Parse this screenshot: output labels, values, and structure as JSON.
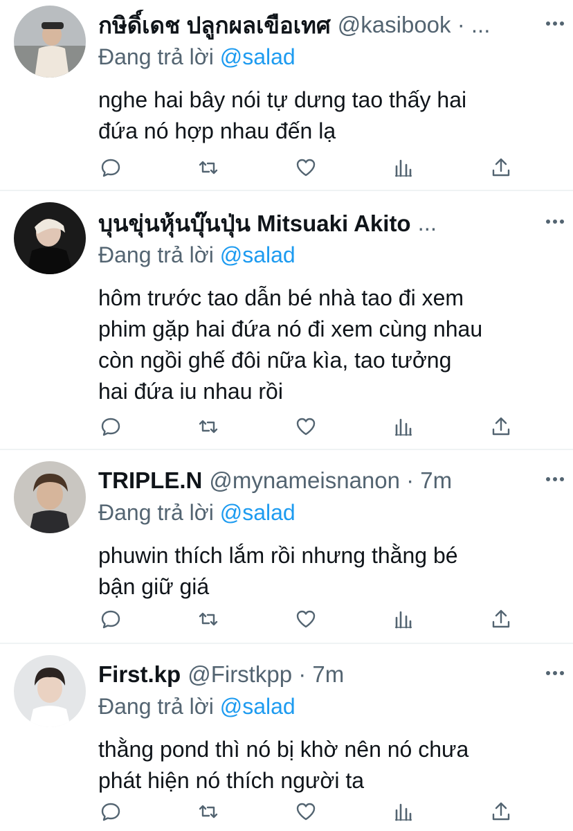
{
  "ui": {
    "accent": "#1d9bf0",
    "muted": "#536471",
    "text": "#0f1419"
  },
  "replies": [
    {
      "display_name": "กษิดิ์เดช ปลูกผลเขือเทศ",
      "handle": "@kasibook · ...",
      "replying_prefix": "Đang trả lời",
      "replying_to": "@salad",
      "text_lines": [
        "nghe hai bây nói tự dưng tao thấy hai",
        "đứa nó hợp nhau đến lạ"
      ]
    },
    {
      "display_name": "บุนขุ่นหุ้นบุ๊นปุ่น Mitsuaki Akito",
      "handle": "...",
      "replying_prefix": "Đang trả lời",
      "replying_to": "@salad",
      "text_lines": [
        "hôm trước tao dẫn bé nhà tao đi xem",
        "phim gặp hai đứa nó đi xem cùng nhau",
        "còn ngồi ghế đôi nữa kìa, tao tưởng",
        "hai đứa iu nhau rồi"
      ]
    },
    {
      "display_name": "TRIPLE.N",
      "handle": "@mynameisnanon · 7m",
      "replying_prefix": "Đang trả lời",
      "replying_to": "@salad",
      "text_lines": [
        "phuwin thích lắm rồi nhưng thằng bé",
        "bận giữ giá"
      ]
    },
    {
      "display_name": "First.kp",
      "handle": "@Firstkpp · 7m",
      "replying_prefix": "Đang trả lời",
      "replying_to": "@salad",
      "text_lines": [
        "thằng pond thì nó bị khờ nên nó chưa",
        "phát hiện nó thích người ta"
      ]
    }
  ]
}
